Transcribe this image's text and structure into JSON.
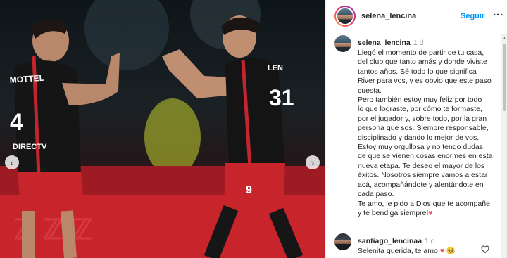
{
  "photo": {
    "jersey_left_name": "MOTTEL",
    "jersey_left_number": "4",
    "jersey_left_sponsor": "DIRECTV",
    "jersey_right_number": "31",
    "jersey_right_name": "LEN",
    "shorts_right_number": "9",
    "prev_icon": "‹",
    "next_icon": "›"
  },
  "header": {
    "username": "selena_lencina",
    "follow_label": "Seguir",
    "more_icon": "···"
  },
  "caption": {
    "username": "selena_lencina",
    "time": "1 d",
    "lines": [
      "Llegó el momento de partir de tu casa,",
      "del club que tanto amás y donde viviste",
      "tantos años. Sé todo lo que significa",
      "River para vos, y es obvio que este paso",
      "cuesta.",
      "Pero también estoy muy feliz por todo",
      "lo que lograste, por cómo te formaste,",
      "por el jugador y, sobre todo, por la gran",
      "persona que sos. Siempre responsable,",
      "disciplinado y dando lo mejor de vos.",
      "Estoy muy orgullosa y no tengo dudas",
      "de que se vienen cosas enormes en esta",
      "nueva etapa. Te deseo el mayor de los",
      "éxitos. Nosotros siempre vamos a estar",
      "acá, acompañándote y alentándote en",
      "cada paso.",
      "Te amo, le pido a Dios que te acompañe",
      "y te bendiga siempre!"
    ],
    "heart": "♥"
  },
  "reply": {
    "username": "santiago_lencinaa",
    "time": "1 d",
    "text": "Selenita querida, te amo",
    "emojis": "♥ 🥺"
  },
  "scrollbar": {
    "up_arrow": "▲"
  }
}
